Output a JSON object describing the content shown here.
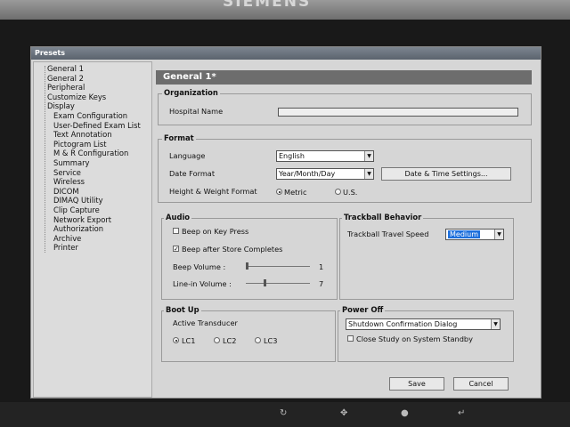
{
  "bezel": {
    "brand": "SIEMENS"
  },
  "window": {
    "title": "Presets"
  },
  "tree": {
    "items": [
      "General 1",
      "General 2",
      "Peripheral",
      "Customize Keys",
      "Display",
      "Exam Configuration",
      "User-Defined Exam List",
      "Text Annotation",
      "Pictogram List",
      "M & R Configuration",
      "Summary",
      "Service",
      "Wireless",
      "DICOM",
      "DIMAQ Utility",
      "Clip Capture",
      "Network Export",
      "Authorization",
      "Archive",
      "Printer"
    ]
  },
  "header": {
    "title": "General 1*"
  },
  "organization": {
    "legend": "Organization",
    "hospital_label": "Hospital Name",
    "hospital_value": ""
  },
  "format": {
    "legend": "Format",
    "language_label": "Language",
    "language_value": "English",
    "date_label": "Date Format",
    "date_value": "Year/Month/Day",
    "datetime_button": "Date & Time Settings...",
    "hw_label": "Height & Weight Format",
    "hw_options": [
      "Metric",
      "U.S."
    ],
    "hw_selected": "Metric"
  },
  "audio": {
    "legend": "Audio",
    "beep_key": "Beep on Key Press",
    "beep_key_checked": false,
    "beep_store": "Beep after Store Completes",
    "beep_store_checked": true,
    "beep_volume_label": "Beep Volume :",
    "beep_volume": "1",
    "linein_label": "Line-in Volume :",
    "linein_volume": "7"
  },
  "trackball": {
    "legend": "Trackball Behavior",
    "speed_label": "Trackball Travel Speed",
    "speed_value": "Medium"
  },
  "bootup": {
    "legend": "Boot Up",
    "transducer_label": "Active Transducer",
    "options": [
      "LC1",
      "LC2",
      "LC3"
    ],
    "selected": "LC1"
  },
  "poweroff": {
    "legend": "Power Off",
    "mode_value": "Shutdown Confirmation Dialog",
    "close_study": "Close Study on System Standby",
    "close_study_checked": false
  },
  "actions": {
    "save": "Save",
    "cancel": "Cancel"
  },
  "colors": {
    "titlebar": "#5b636d",
    "selection": "#1d6fdc",
    "header": "#6d6d6d"
  },
  "hardware_icons": [
    "power-cycle-icon",
    "trackball-icon",
    "dot-icon",
    "back-icon"
  ]
}
